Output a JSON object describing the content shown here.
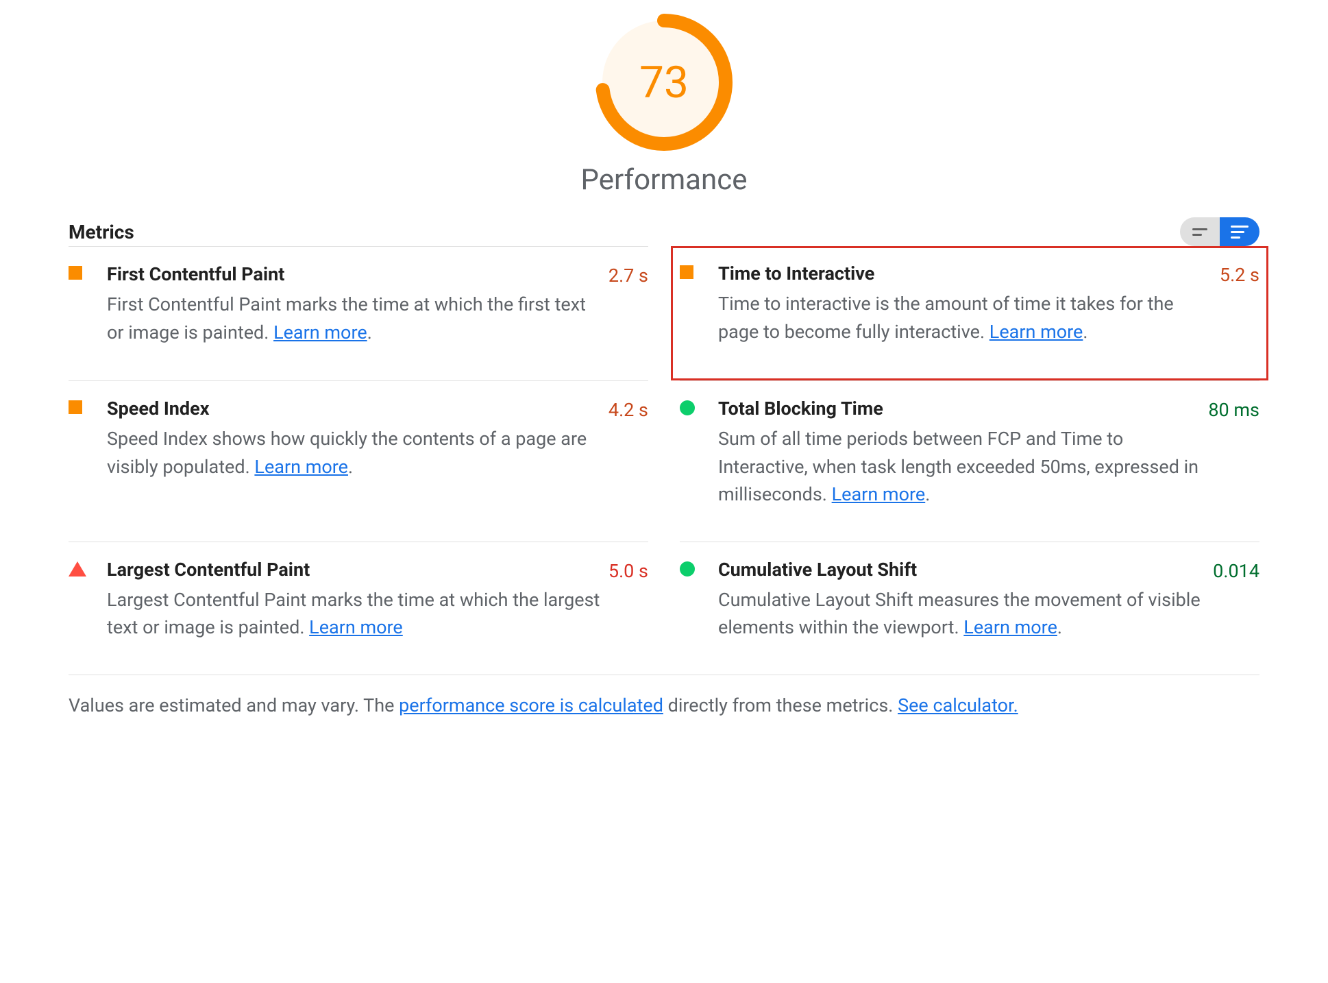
{
  "score": {
    "value": "73",
    "title": "Performance",
    "percent": 73
  },
  "metrics_label": "Metrics",
  "learn_more": "Learn more",
  "metrics": [
    {
      "id": "fcp",
      "icon": "square-orange",
      "title": "First Contentful Paint",
      "desc": "First Contentful Paint marks the time at which the first text or image is painted. ",
      "value": "2.7 s",
      "value_class": "value-orange",
      "highlighted": false,
      "trailing_period": true
    },
    {
      "id": "tti",
      "icon": "square-orange",
      "title": "Time to Interactive",
      "desc": "Time to interactive is the amount of time it takes for the page to become fully interactive. ",
      "value": "5.2 s",
      "value_class": "value-orange",
      "highlighted": true,
      "trailing_period": true
    },
    {
      "id": "si",
      "icon": "square-orange",
      "title": "Speed Index",
      "desc": "Speed Index shows how quickly the contents of a page are visibly populated. ",
      "value": "4.2 s",
      "value_class": "value-orange",
      "highlighted": false,
      "trailing_period": true
    },
    {
      "id": "tbt",
      "icon": "circle-green",
      "title": "Total Blocking Time",
      "desc": "Sum of all time periods between FCP and Time to Interactive, when task length exceeded 50ms, expressed in milliseconds. ",
      "value": "80 ms",
      "value_class": "value-green",
      "highlighted": false,
      "trailing_period": true
    },
    {
      "id": "lcp",
      "icon": "triangle-red",
      "title": "Largest Contentful Paint",
      "desc": "Largest Contentful Paint marks the time at which the largest text or image is painted. ",
      "value": "5.0 s",
      "value_class": "value-red",
      "highlighted": false,
      "trailing_period": false
    },
    {
      "id": "cls",
      "icon": "circle-green",
      "title": "Cumulative Layout Shift",
      "desc": "Cumulative Layout Shift measures the movement of visible elements within the viewport. ",
      "value": "0.014",
      "value_class": "value-green",
      "highlighted": false,
      "trailing_period": true
    }
  ],
  "footer": {
    "pre": "Values are estimated and may vary. The ",
    "link1": "performance score is calculated",
    "mid": " directly from these metrics. ",
    "link2": "See calculator."
  }
}
